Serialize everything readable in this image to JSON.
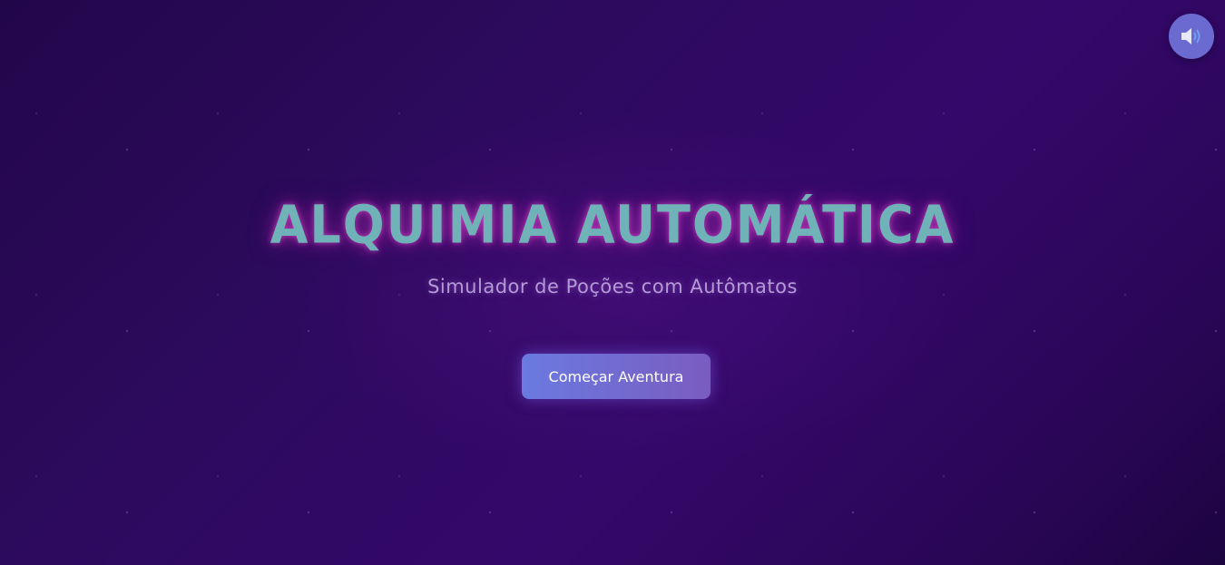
{
  "screen": {
    "title": "ALQUIMIA AUTOMÁTICA",
    "subtitle": "Simulador de Poções com Autômatos",
    "start_button": "Começar Aventura"
  },
  "controls": {
    "sound_icon": "speaker-volume-icon"
  },
  "colors": {
    "background": "#2c0a5c",
    "title": "#6fb3b8",
    "title_glow": "#e050c8",
    "subtitle": "#b49ad6",
    "button_start": "#6a7ae0",
    "button_end": "#7a5cc0",
    "sound_button": "#6a6ad0"
  }
}
